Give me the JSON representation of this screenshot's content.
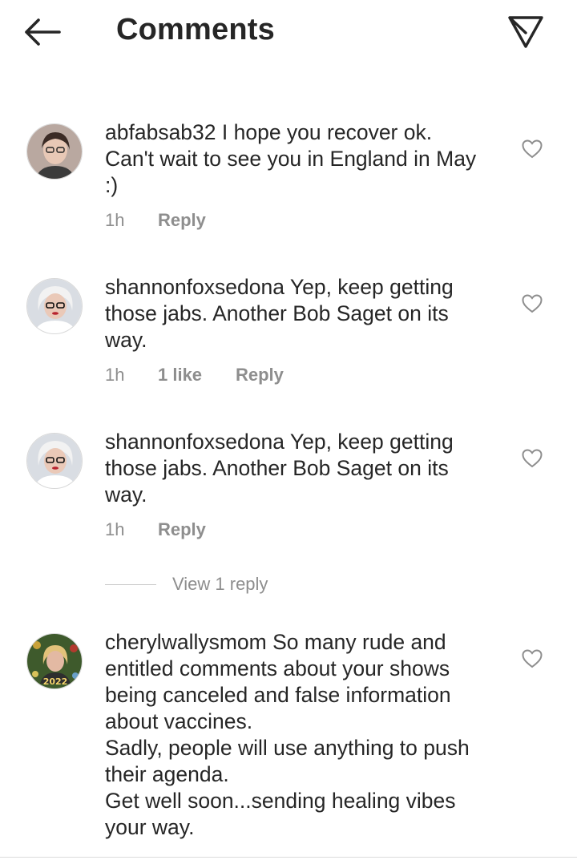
{
  "header": {
    "title": "Comments"
  },
  "comments": [
    {
      "username": "abfabsab32",
      "text": " I hope you recover ok.\nCan't wait to see you in England in May :)",
      "time": "1h",
      "likes": "",
      "reply_label": "Reply"
    },
    {
      "username": "shannonfoxsedona",
      "text": " Yep, keep getting those jabs.  Another Bob Saget on its way.",
      "time": "1h",
      "likes": "1 like",
      "reply_label": "Reply"
    },
    {
      "username": "shannonfoxsedona",
      "text": " Yep, keep getting those jabs.  Another Bob Saget on its way.",
      "time": "1h",
      "likes": "",
      "reply_label": "Reply",
      "view_replies_label": "View 1 reply"
    },
    {
      "username": "cherylwallysmom",
      "text": " So many rude and entitled comments about your shows being canceled and false information about vaccines.\nSadly, people will use anything to push their agenda.\nGet well soon...sending healing vibes your way.",
      "avatar_caption": "2022"
    }
  ],
  "icons": {
    "back": "arrow-left-icon",
    "share": "paper-plane-icon",
    "like": "heart-outline-icon"
  },
  "colors": {
    "text": "#262626",
    "secondary": "#8e8e8e",
    "background": "#ffffff"
  }
}
